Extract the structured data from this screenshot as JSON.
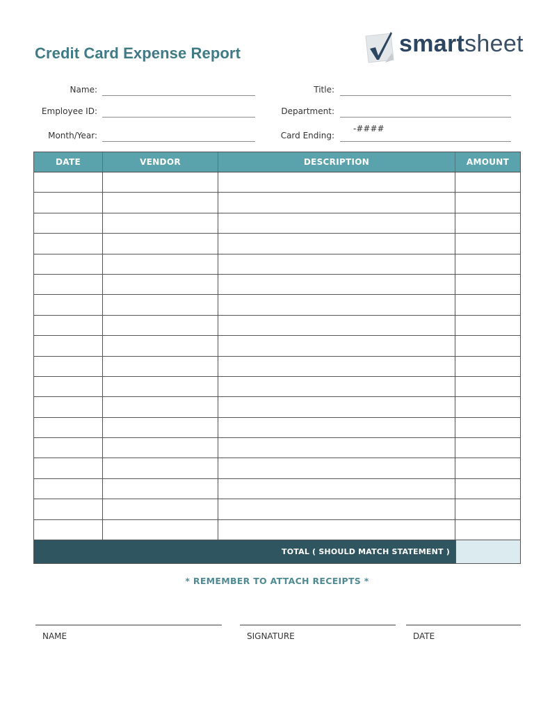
{
  "header": {
    "title": "Credit Card Expense Report",
    "logo": {
      "icon": "checkmark-icon",
      "text_bold": "smart",
      "text_regular": "sheet"
    }
  },
  "fields": {
    "left": [
      {
        "label": "Name:",
        "value": ""
      },
      {
        "label": "Employee ID:",
        "value": ""
      },
      {
        "label": "Month/Year:",
        "value": ""
      }
    ],
    "right": [
      {
        "label": "Title:",
        "value": ""
      },
      {
        "label": "Department:",
        "value": ""
      },
      {
        "label": "Card Ending:",
        "value": "-####"
      }
    ]
  },
  "table": {
    "columns": [
      "DATE",
      "VENDOR",
      "DESCRIPTION",
      "AMOUNT"
    ],
    "rows": [
      [
        "",
        "",
        "",
        ""
      ],
      [
        "",
        "",
        "",
        ""
      ],
      [
        "",
        "",
        "",
        ""
      ],
      [
        "",
        "",
        "",
        ""
      ],
      [
        "",
        "",
        "",
        ""
      ],
      [
        "",
        "",
        "",
        ""
      ],
      [
        "",
        "",
        "",
        ""
      ],
      [
        "",
        "",
        "",
        ""
      ],
      [
        "",
        "",
        "",
        ""
      ],
      [
        "",
        "",
        "",
        ""
      ],
      [
        "",
        "",
        "",
        ""
      ],
      [
        "",
        "",
        "",
        ""
      ],
      [
        "",
        "",
        "",
        ""
      ],
      [
        "",
        "",
        "",
        ""
      ],
      [
        "",
        "",
        "",
        ""
      ],
      [
        "",
        "",
        "",
        ""
      ],
      [
        "",
        "",
        "",
        ""
      ],
      [
        "",
        "",
        "",
        ""
      ]
    ],
    "total_label": "TOTAL ( SHOULD MATCH STATEMENT )",
    "total_value": ""
  },
  "reminder": "* REMEMBER TO ATTACH RECEIPTS *",
  "signature": {
    "name_label": "NAME",
    "signature_label": "SIGNATURE",
    "date_label": "DATE"
  },
  "colors": {
    "title": "#3f7a85",
    "header_bg": "#5aa3ad",
    "total_bg": "#2f5560",
    "total_cell_bg": "#dcebf0",
    "reminder": "#4f8b93",
    "logo_text": "#3a4f66"
  }
}
